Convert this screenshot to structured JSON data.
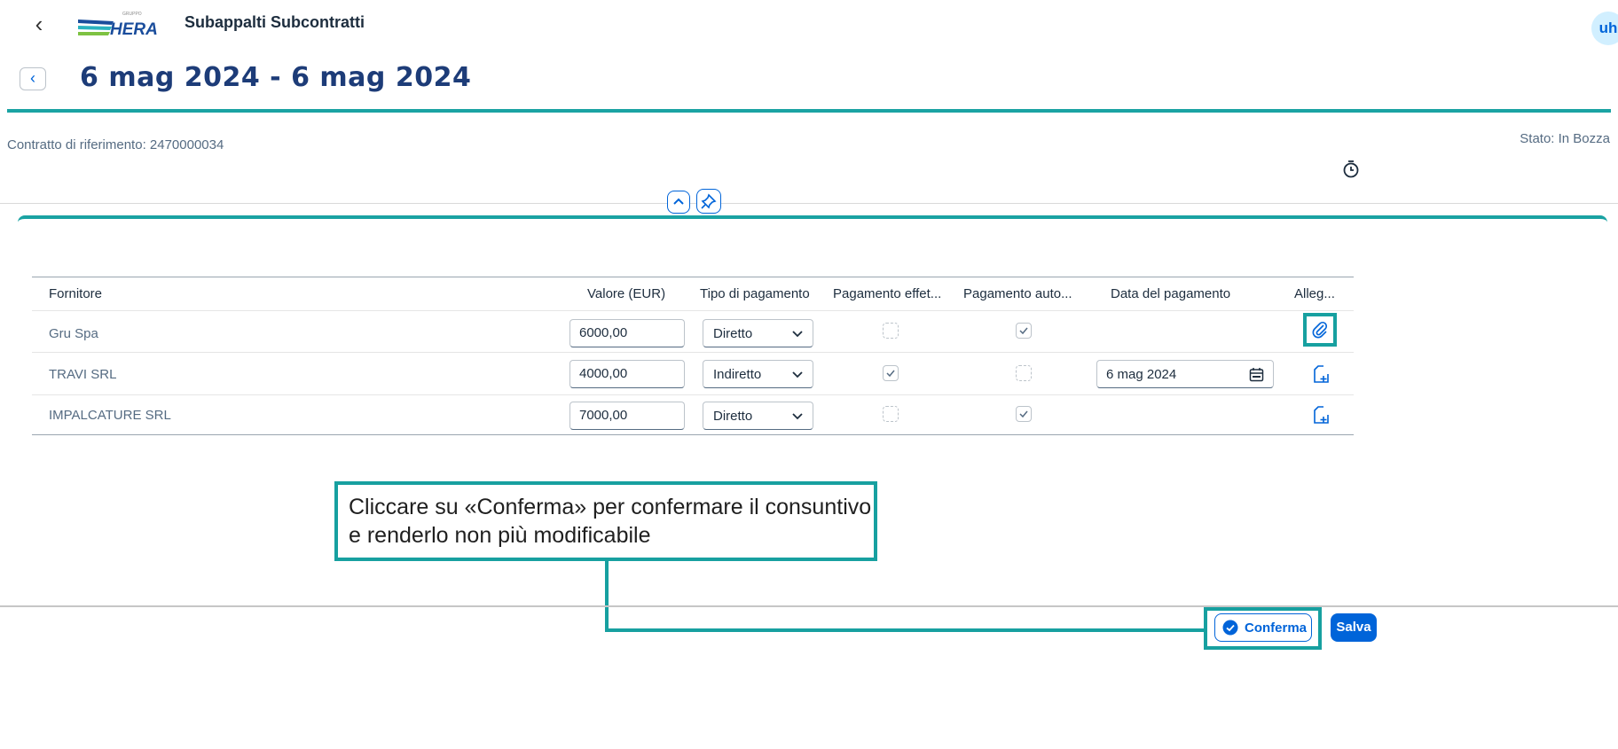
{
  "shell": {
    "app_title": "Subappalti Subcontratti",
    "avatar_initials": "uh",
    "logo_text": "HERA",
    "logo_group": "GRUPPO"
  },
  "header": {
    "title": "6 mag 2024 - 6 mag 2024",
    "contract_label": "Contratto di riferimento: 2470000034",
    "status_label": "Stato: In Bozza"
  },
  "table": {
    "columns": [
      "Fornitore",
      "Valore (EUR)",
      "Tipo di pagamento",
      "Pagamento effet...",
      "Pagamento auto...",
      "Data del pagamento",
      "Alleg..."
    ],
    "rows": [
      {
        "fornitore": "Gru Spa",
        "valore": "6000,00",
        "tipo": "Diretto",
        "effettivo": false,
        "automatico": true,
        "data": "",
        "allegato": "paperclip-icon"
      },
      {
        "fornitore": "TRAVI SRL",
        "valore": "4000,00",
        "tipo": "Indiretto",
        "effettivo": true,
        "automatico": false,
        "data": "6 mag 2024",
        "allegato": "add-attachment-icon"
      },
      {
        "fornitore": "IMPALCATURE SRL",
        "valore": "7000,00",
        "tipo": "Diretto",
        "effettivo": false,
        "automatico": true,
        "data": "",
        "allegato": "add-attachment-icon"
      }
    ]
  },
  "callout": {
    "text": "Cliccare su «Conferma» per confermare il consuntivo e renderlo non più modificabile"
  },
  "footer": {
    "confirm_label": "Conferma",
    "save_label": "Salva"
  },
  "colors": {
    "accent": "#0064d9",
    "highlight": "#17a0a0",
    "title": "#1d3c78"
  }
}
